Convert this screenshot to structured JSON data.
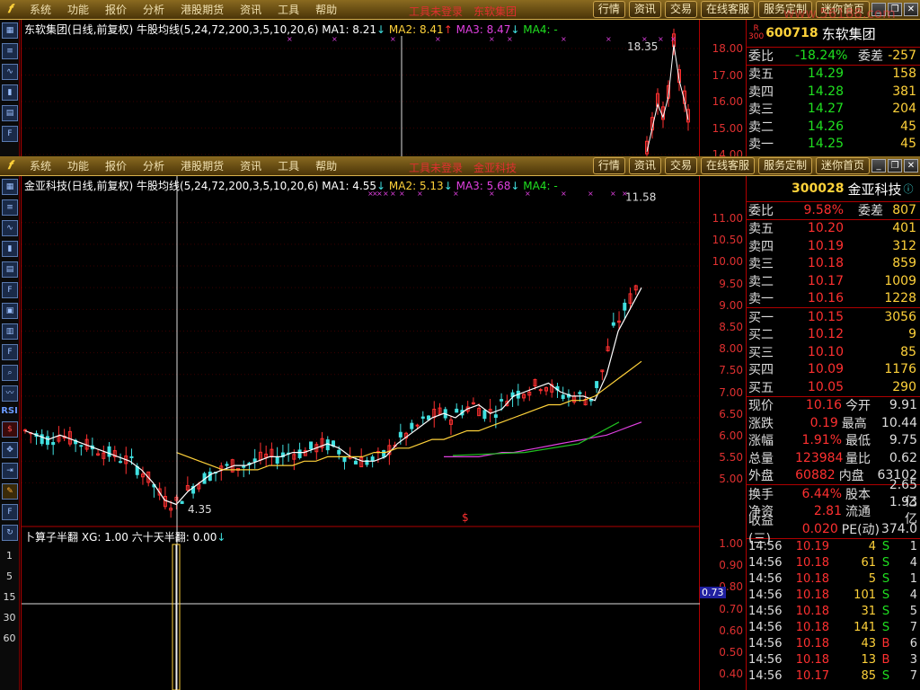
{
  "menu": [
    "系统",
    "功能",
    "报价",
    "分析",
    "港股期货",
    "资讯",
    "工具",
    "帮助"
  ],
  "center_msg": [
    "工具未登录",
    "东软集团"
  ],
  "center_msg2": [
    "工具未登录",
    "金亚科技"
  ],
  "right_buttons": [
    "行情",
    "资讯",
    "交易",
    "在线客服",
    "服务定制",
    "迷你首页"
  ],
  "watermark": "www.56188.com",
  "top": {
    "stock_code": "600718",
    "stock_name": "东软集团",
    "rank": "300",
    "legend": {
      "title": "东软集团(日线,前复权)",
      "formula": "牛股均线(5,24,72,200,3,5,10,20,6)",
      "ma1": "MA1: 8.21",
      "ma2": "MA2: 8.41",
      "ma3": "MA3: 8.47",
      "ma4": "MA4: -"
    },
    "peak_label": "18.35",
    "yticks": [
      "18.00",
      "17.00",
      "16.00",
      "15.00",
      "14.00"
    ],
    "weibi": {
      "label": "委比",
      "value": "-18.24%",
      "label2": "委差",
      "value2": "-257"
    },
    "asks": [
      {
        "label": "卖五",
        "price": "14.29",
        "vol": "158"
      },
      {
        "label": "卖四",
        "price": "14.28",
        "vol": "381"
      },
      {
        "label": "卖三",
        "price": "14.27",
        "vol": "204"
      },
      {
        "label": "卖二",
        "price": "14.26",
        "vol": "45"
      },
      {
        "label": "卖一",
        "price": "14.25",
        "vol": "45"
      }
    ]
  },
  "main": {
    "stock_code": "300028",
    "stock_name": "金亚科技",
    "legend": {
      "title": "金亚科技(日线,前复权)",
      "formula": "牛股均线(5,24,72,200,3,5,10,20,6)",
      "ma1": "MA1: 4.55",
      "ma2": "MA2: 5.13",
      "ma3": "MA3: 5.68",
      "ma4": "MA4: -"
    },
    "peak_label": "11.58",
    "low_label": "4.35",
    "dollar_mark": "$",
    "yticks": [
      "11.00",
      "10.50",
      "10.00",
      "9.50",
      "9.00",
      "8.50",
      "8.00",
      "7.50",
      "7.00",
      "6.50",
      "6.00",
      "5.50",
      "5.00"
    ],
    "weibi": {
      "label": "委比",
      "value": "9.58%",
      "label2": "委差",
      "value2": "807"
    },
    "asks": [
      {
        "label": "卖五",
        "price": "10.20",
        "vol": "401"
      },
      {
        "label": "卖四",
        "price": "10.19",
        "vol": "312"
      },
      {
        "label": "卖三",
        "price": "10.18",
        "vol": "859"
      },
      {
        "label": "卖二",
        "price": "10.17",
        "vol": "1009"
      },
      {
        "label": "卖一",
        "price": "10.16",
        "vol": "1228"
      }
    ],
    "bids": [
      {
        "label": "买一",
        "price": "10.15",
        "vol": "3056"
      },
      {
        "label": "买二",
        "price": "10.12",
        "vol": "9"
      },
      {
        "label": "买三",
        "price": "10.10",
        "vol": "85"
      },
      {
        "label": "买四",
        "price": "10.09",
        "vol": "1176"
      },
      {
        "label": "买五",
        "price": "10.05",
        "vol": "290"
      }
    ],
    "stats": [
      {
        "l1": "现价",
        "v1": "10.16",
        "l2": "今开",
        "v2": "9.91"
      },
      {
        "l1": "涨跌",
        "v1": "0.19",
        "l2": "最高",
        "v2": "10.44"
      },
      {
        "l1": "涨幅",
        "v1": "1.91%",
        "l2": "最低",
        "v2": "9.75"
      },
      {
        "l1": "总量",
        "v1": "123984",
        "l2": "量比",
        "v2": "0.62"
      },
      {
        "l1": "外盘",
        "v1": "60882",
        "l2": "内盘",
        "v2": "63102"
      }
    ],
    "stats2": [
      {
        "l1": "换手",
        "v1": "6.44%",
        "l2": "股本",
        "v2": "2.65亿"
      },
      {
        "l1": "净资",
        "v1": "2.81",
        "l2": "流通",
        "v2": "1.93亿"
      },
      {
        "l1": "收益(三)",
        "v1": "0.020",
        "l2": "PE(动)",
        "v2": "374.0"
      }
    ],
    "ticks": [
      {
        "t": "14:56",
        "p": "10.19",
        "v": "4",
        "d": "S",
        "n": "1"
      },
      {
        "t": "14:56",
        "p": "10.18",
        "v": "61",
        "d": "S",
        "n": "4"
      },
      {
        "t": "14:56",
        "p": "10.18",
        "v": "5",
        "d": "S",
        "n": "1"
      },
      {
        "t": "14:56",
        "p": "10.18",
        "v": "101",
        "d": "S",
        "n": "4"
      },
      {
        "t": "14:56",
        "p": "10.18",
        "v": "31",
        "d": "S",
        "n": "5"
      },
      {
        "t": "14:56",
        "p": "10.18",
        "v": "141",
        "d": "S",
        "n": "7"
      },
      {
        "t": "14:56",
        "p": "10.18",
        "v": "43",
        "d": "B",
        "n": "6"
      },
      {
        "t": "14:56",
        "p": "10.18",
        "v": "13",
        "d": "B",
        "n": "3"
      },
      {
        "t": "14:56",
        "p": "10.17",
        "v": "85",
        "d": "S",
        "n": "7"
      }
    ]
  },
  "indicator": {
    "legend": "卜算子半翻",
    "xg": "XG: 1.00",
    "sixty": "六十天半翻: 0.00",
    "yticks": [
      "1.00",
      "0.90",
      "0.80",
      "0.70",
      "0.60",
      "0.50",
      "0.40"
    ],
    "current": "0.73"
  },
  "left_scale": [
    "1",
    "5",
    "15",
    "30",
    "60"
  ],
  "left_rsi": "RSI",
  "chart_data": {
    "type": "line",
    "title": "金亚科技(日线,前复权)",
    "ylim": [
      4.2,
      11.7
    ],
    "series": [
      {
        "name": "MA1",
        "values": [
          6.2,
          6.1,
          6.0,
          6.1,
          6.0,
          5.9,
          5.8,
          5.7,
          5.6,
          5.5,
          5.3,
          5.0,
          4.6,
          4.5,
          4.8,
          5.0,
          5.2,
          5.3,
          5.4,
          5.4,
          5.5,
          5.6,
          5.6,
          5.7,
          5.7,
          5.8,
          5.9,
          5.8,
          5.6,
          5.5,
          5.5,
          5.6,
          5.9,
          6.1,
          6.3,
          6.5,
          6.6,
          6.5,
          6.7,
          6.8,
          6.6,
          6.7,
          7.0,
          7.1,
          7.2,
          7.3,
          7.1,
          7.0,
          7.0,
          6.9,
          7.5,
          8.5,
          9.0,
          9.5
        ]
      },
      {
        "name": "MA2",
        "values": [
          null,
          null,
          null,
          null,
          null,
          null,
          null,
          null,
          null,
          null,
          null,
          null,
          null,
          5.7,
          5.6,
          5.5,
          5.4,
          5.3,
          5.3,
          5.3,
          5.3,
          5.4,
          5.4,
          5.4,
          5.5,
          5.5,
          5.6,
          5.6,
          5.6,
          5.6,
          5.7,
          5.7,
          5.8,
          5.8,
          5.9,
          6.0,
          6.0,
          6.1,
          6.2,
          6.2,
          6.3,
          6.4,
          6.5,
          6.6,
          6.7,
          6.8,
          6.8,
          6.9,
          6.9,
          7.0,
          7.2,
          7.4,
          7.6,
          7.8
        ]
      },
      {
        "name": "MA3",
        "values": [
          null,
          null,
          null,
          null,
          null,
          null,
          null,
          null,
          null,
          null,
          null,
          null,
          null,
          null,
          null,
          null,
          null,
          null,
          null,
          null,
          null,
          null,
          null,
          null,
          null,
          null,
          null,
          null,
          null,
          null,
          null,
          null,
          null,
          null,
          null,
          null,
          5.6,
          5.6,
          5.6,
          5.6,
          5.65,
          5.7,
          5.7,
          5.75,
          5.8,
          5.85,
          5.9,
          5.95,
          6.0,
          6.05,
          6.1,
          6.2,
          6.3,
          6.4
        ]
      }
    ]
  }
}
